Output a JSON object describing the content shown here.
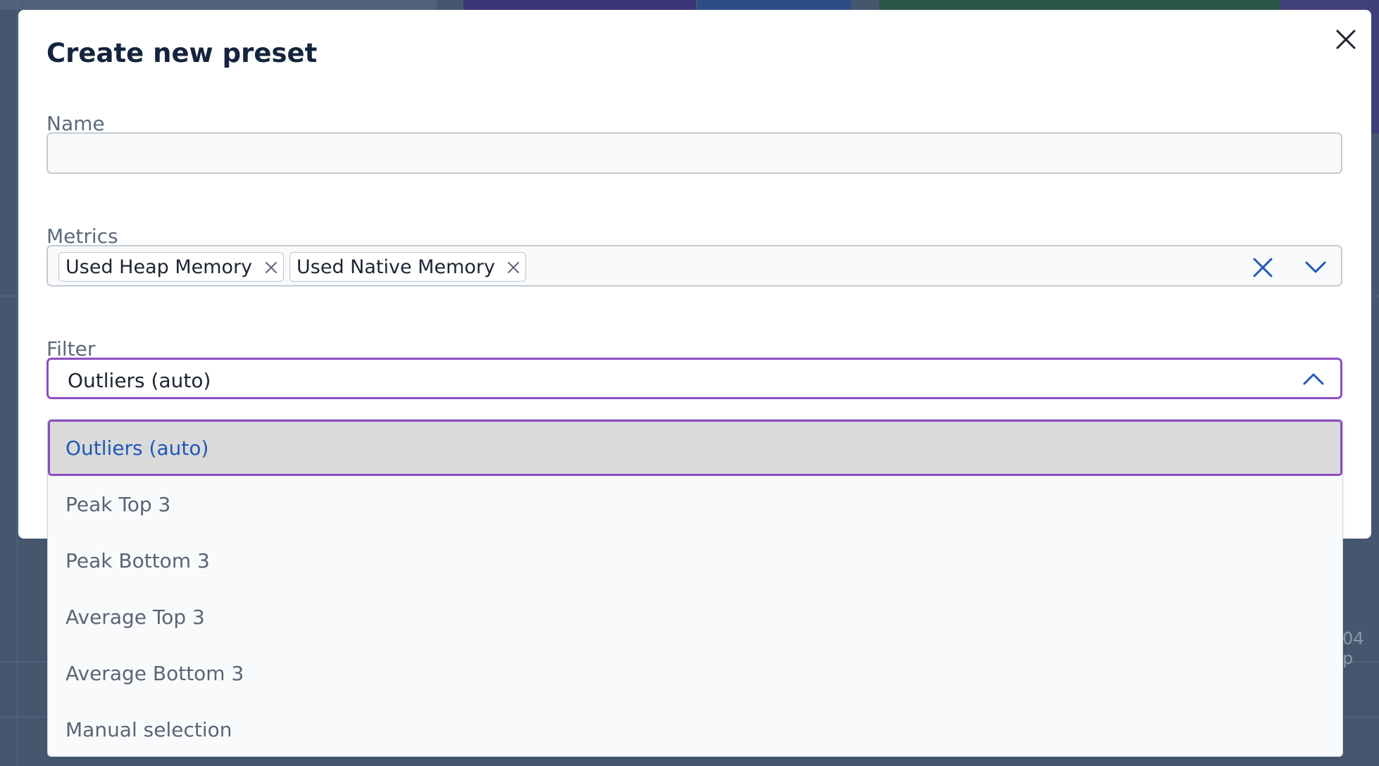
{
  "modal": {
    "title": "Create new preset",
    "close_icon": "close-icon"
  },
  "name_field": {
    "label": "Name",
    "value": "",
    "placeholder": ""
  },
  "metrics_field": {
    "label": "Metrics",
    "chips": [
      {
        "label": "Used Heap Memory"
      },
      {
        "label": "Used Native Memory"
      }
    ],
    "clear_icon": "clear-icon",
    "expand_icon": "chevron-down-icon"
  },
  "filter_field": {
    "label": "Filter",
    "selected_value": "Outliers (auto)",
    "expand_icon": "chevron-up-icon",
    "options": [
      {
        "label": "Outliers (auto)",
        "selected": true
      },
      {
        "label": "Peak Top 3",
        "selected": false
      },
      {
        "label": "Peak Bottom 3",
        "selected": false
      },
      {
        "label": "Average Top 3",
        "selected": false
      },
      {
        "label": "Average Bottom 3",
        "selected": false
      },
      {
        "label": "Manual selection",
        "selected": false
      }
    ]
  },
  "background": {
    "peek_text": "04 p"
  },
  "colors": {
    "focus_border": "#8e4cc5",
    "selected_option_text": "#1f58b8",
    "icon_blue": "#1f58b8",
    "title_text": "#15243d"
  }
}
